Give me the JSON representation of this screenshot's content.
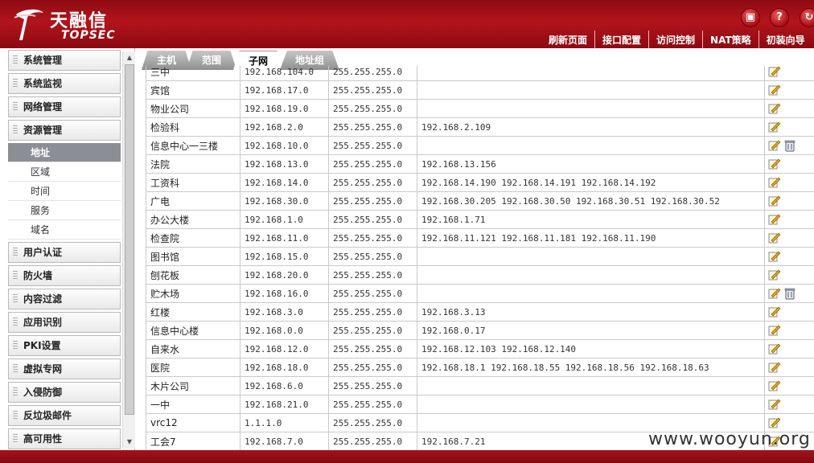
{
  "brand": {
    "name_cn": "天融信",
    "name_en": "TOPSEC"
  },
  "top_icons": [
    "save-icon",
    "help-icon",
    "refresh-icon"
  ],
  "nav": [
    "刷新页面",
    "接口配置",
    "访问控制",
    "NAT策略",
    "初装向导"
  ],
  "sidebar": {
    "sections": [
      "系统管理",
      "系统监视",
      "网络管理",
      "资源管理",
      "用户认证",
      "防火墙",
      "内容过滤",
      "应用识别",
      "PKI设置",
      "虚拟专网",
      "入侵防御",
      "反垃圾邮件",
      "高可用性"
    ],
    "resource_sub": [
      "地址",
      "区域",
      "时间",
      "服务",
      "域名"
    ],
    "active_sub": "地址"
  },
  "tabs": [
    "主机",
    "范围",
    "子网",
    "地址组"
  ],
  "active_tab": "子网",
  "rows": [
    {
      "name": "三中",
      "ip": "192.168.104.0",
      "mask": "255.255.255.0",
      "hosts": "",
      "delete": false
    },
    {
      "name": "宾馆",
      "ip": "192.168.17.0",
      "mask": "255.255.255.0",
      "hosts": "",
      "delete": false
    },
    {
      "name": "物业公司",
      "ip": "192.168.19.0",
      "mask": "255.255.255.0",
      "hosts": "",
      "delete": false
    },
    {
      "name": "检验科",
      "ip": "192.168.2.0",
      "mask": "255.255.255.0",
      "hosts": "192.168.2.109",
      "delete": false
    },
    {
      "name": "信息中心一三楼",
      "ip": "192.168.10.0",
      "mask": "255.255.255.0",
      "hosts": "",
      "delete": true
    },
    {
      "name": "法院",
      "ip": "192.168.13.0",
      "mask": "255.255.255.0",
      "hosts": "192.168.13.156",
      "delete": false
    },
    {
      "name": "工资科",
      "ip": "192.168.14.0",
      "mask": "255.255.255.0",
      "hosts": "192.168.14.190 192.168.14.191 192.168.14.192",
      "delete": false
    },
    {
      "name": "广电",
      "ip": "192.168.30.0",
      "mask": "255.255.255.0",
      "hosts": "192.168.30.205 192.168.30.50 192.168.30.51 192.168.30.52",
      "delete": false
    },
    {
      "name": "办公大楼",
      "ip": "192.168.1.0",
      "mask": "255.255.255.0",
      "hosts": "192.168.1.71",
      "delete": false
    },
    {
      "name": "检查院",
      "ip": "192.168.11.0",
      "mask": "255.255.255.0",
      "hosts": "192.168.11.121 192.168.11.181 192.168.11.190",
      "delete": false
    },
    {
      "name": "图书馆",
      "ip": "192.168.15.0",
      "mask": "255.255.255.0",
      "hosts": "",
      "delete": false
    },
    {
      "name": "刨花板",
      "ip": "192.168.20.0",
      "mask": "255.255.255.0",
      "hosts": "",
      "delete": false
    },
    {
      "name": "贮木场",
      "ip": "192.168.16.0",
      "mask": "255.255.255.0",
      "hosts": "",
      "delete": true
    },
    {
      "name": "红楼",
      "ip": "192.168.3.0",
      "mask": "255.255.255.0",
      "hosts": "192.168.3.13",
      "delete": false
    },
    {
      "name": "信息中心楼",
      "ip": "192.168.0.0",
      "mask": "255.255.255.0",
      "hosts": "192.168.0.17",
      "delete": false
    },
    {
      "name": "自来水",
      "ip": "192.168.12.0",
      "mask": "255.255.255.0",
      "hosts": "192.168.12.103 192.168.12.140",
      "delete": false
    },
    {
      "name": "医院",
      "ip": "192.168.18.0",
      "mask": "255.255.255.0",
      "hosts": "192.168.18.1 192.168.18.55 192.168.18.56 192.168.18.63",
      "delete": false
    },
    {
      "name": "木片公司",
      "ip": "192.168.6.0",
      "mask": "255.255.255.0",
      "hosts": "",
      "delete": false
    },
    {
      "name": "一中",
      "ip": "192.168.21.0",
      "mask": "255.255.255.0",
      "hosts": "",
      "delete": false
    },
    {
      "name": "vrc12",
      "ip": "1.1.1.0",
      "mask": "255.255.255.0",
      "hosts": "",
      "delete": false
    },
    {
      "name": "工会7",
      "ip": "192.168.7.0",
      "mask": "255.255.255.0",
      "hosts": "192.168.7.21",
      "delete": false
    }
  ],
  "watermark": "www.wooyun.org",
  "colors": {
    "brand_red": "#b3141c",
    "active_sub_bg": "#8b8f95"
  }
}
